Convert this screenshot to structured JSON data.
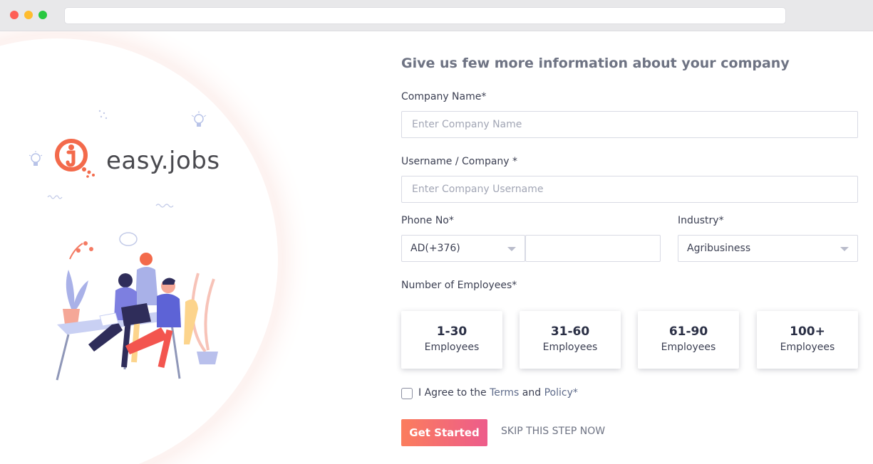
{
  "browser": {
    "url": ""
  },
  "brand": {
    "name": "easy.jobs",
    "accent": "#f36a4b"
  },
  "form": {
    "heading": "Give us few more information about your company",
    "company_name": {
      "label": "Company Name*",
      "placeholder": "Enter Company Name",
      "value": ""
    },
    "username": {
      "label": "Username / Company *",
      "placeholder": "Enter Company Username",
      "value": ""
    },
    "phone": {
      "label": "Phone No*",
      "country_code": "AD(+376)",
      "value": ""
    },
    "industry": {
      "label": "Industry*",
      "selected": "Agribusiness"
    },
    "employees": {
      "label": "Number of Employees*",
      "options": [
        {
          "range": "1-30",
          "unit": "Employees"
        },
        {
          "range": "31-60",
          "unit": "Employees"
        },
        {
          "range": "61-90",
          "unit": "Employees"
        },
        {
          "range": "100+",
          "unit": "Employees"
        }
      ]
    },
    "agree": {
      "prefix": "I Agree to the",
      "terms": "Terms",
      "and": "and",
      "policy": "Policy*",
      "checked": false
    },
    "submit_label": "Get Started",
    "skip_label": "SKIP THIS STEP NOW"
  }
}
